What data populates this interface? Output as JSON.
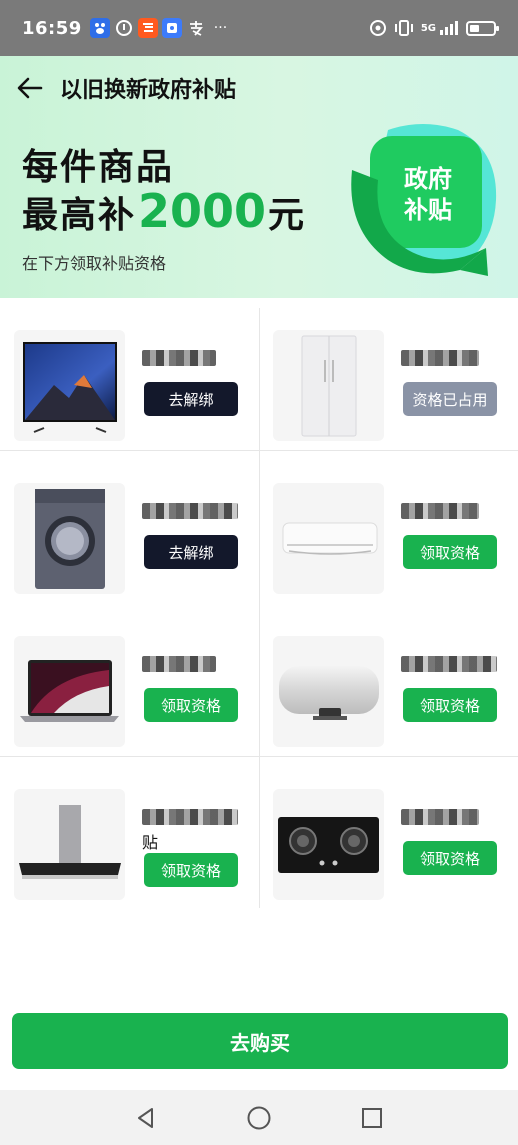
{
  "status_bar": {
    "time": "16:59",
    "app_icons": [
      "baidu-app-icon",
      "app-icon",
      "taobao-app-icon",
      "app-icon",
      "alipay-app-icon"
    ],
    "more": "···",
    "network": "5G"
  },
  "header": {
    "title": "以旧换新政府补贴"
  },
  "banner": {
    "line1": "每件商品",
    "line2_prefix": "最高补",
    "amount": "2000",
    "line2_suffix": "元",
    "subtitle": "在下方领取补贴资格",
    "badge_line1": "政府",
    "badge_line2": "补贴"
  },
  "products": [
    {
      "image": "tv-image",
      "name_tail": "",
      "button": "去解绑",
      "button_style": "dark"
    },
    {
      "image": "refrigerator-image",
      "name_tail": "",
      "button": "资格已占用",
      "button_style": "gray"
    },
    {
      "image": "washing-machine-image",
      "name_tail": "",
      "button": "去解绑",
      "button_style": "dark"
    },
    {
      "image": "air-conditioner-image",
      "name_tail": "",
      "button": "领取资格",
      "button_style": "green"
    },
    {
      "image": "laptop-image",
      "name_tail": "",
      "button": "领取资格",
      "button_style": "green"
    },
    {
      "image": "water-heater-image",
      "name_tail": "",
      "button": "领取资格",
      "button_style": "green"
    },
    {
      "image": "range-hood-image",
      "name_tail": "贴",
      "button": "领取资格",
      "button_style": "green"
    },
    {
      "image": "gas-stove-image",
      "name_tail": "",
      "button": "领取资格",
      "button_style": "green"
    }
  ],
  "buy_button": "去购买",
  "colors": {
    "accent_green": "#19b24f",
    "dark_button": "#13182b",
    "gray_button": "#8a93a6",
    "header_bg": "#d2f5df"
  }
}
